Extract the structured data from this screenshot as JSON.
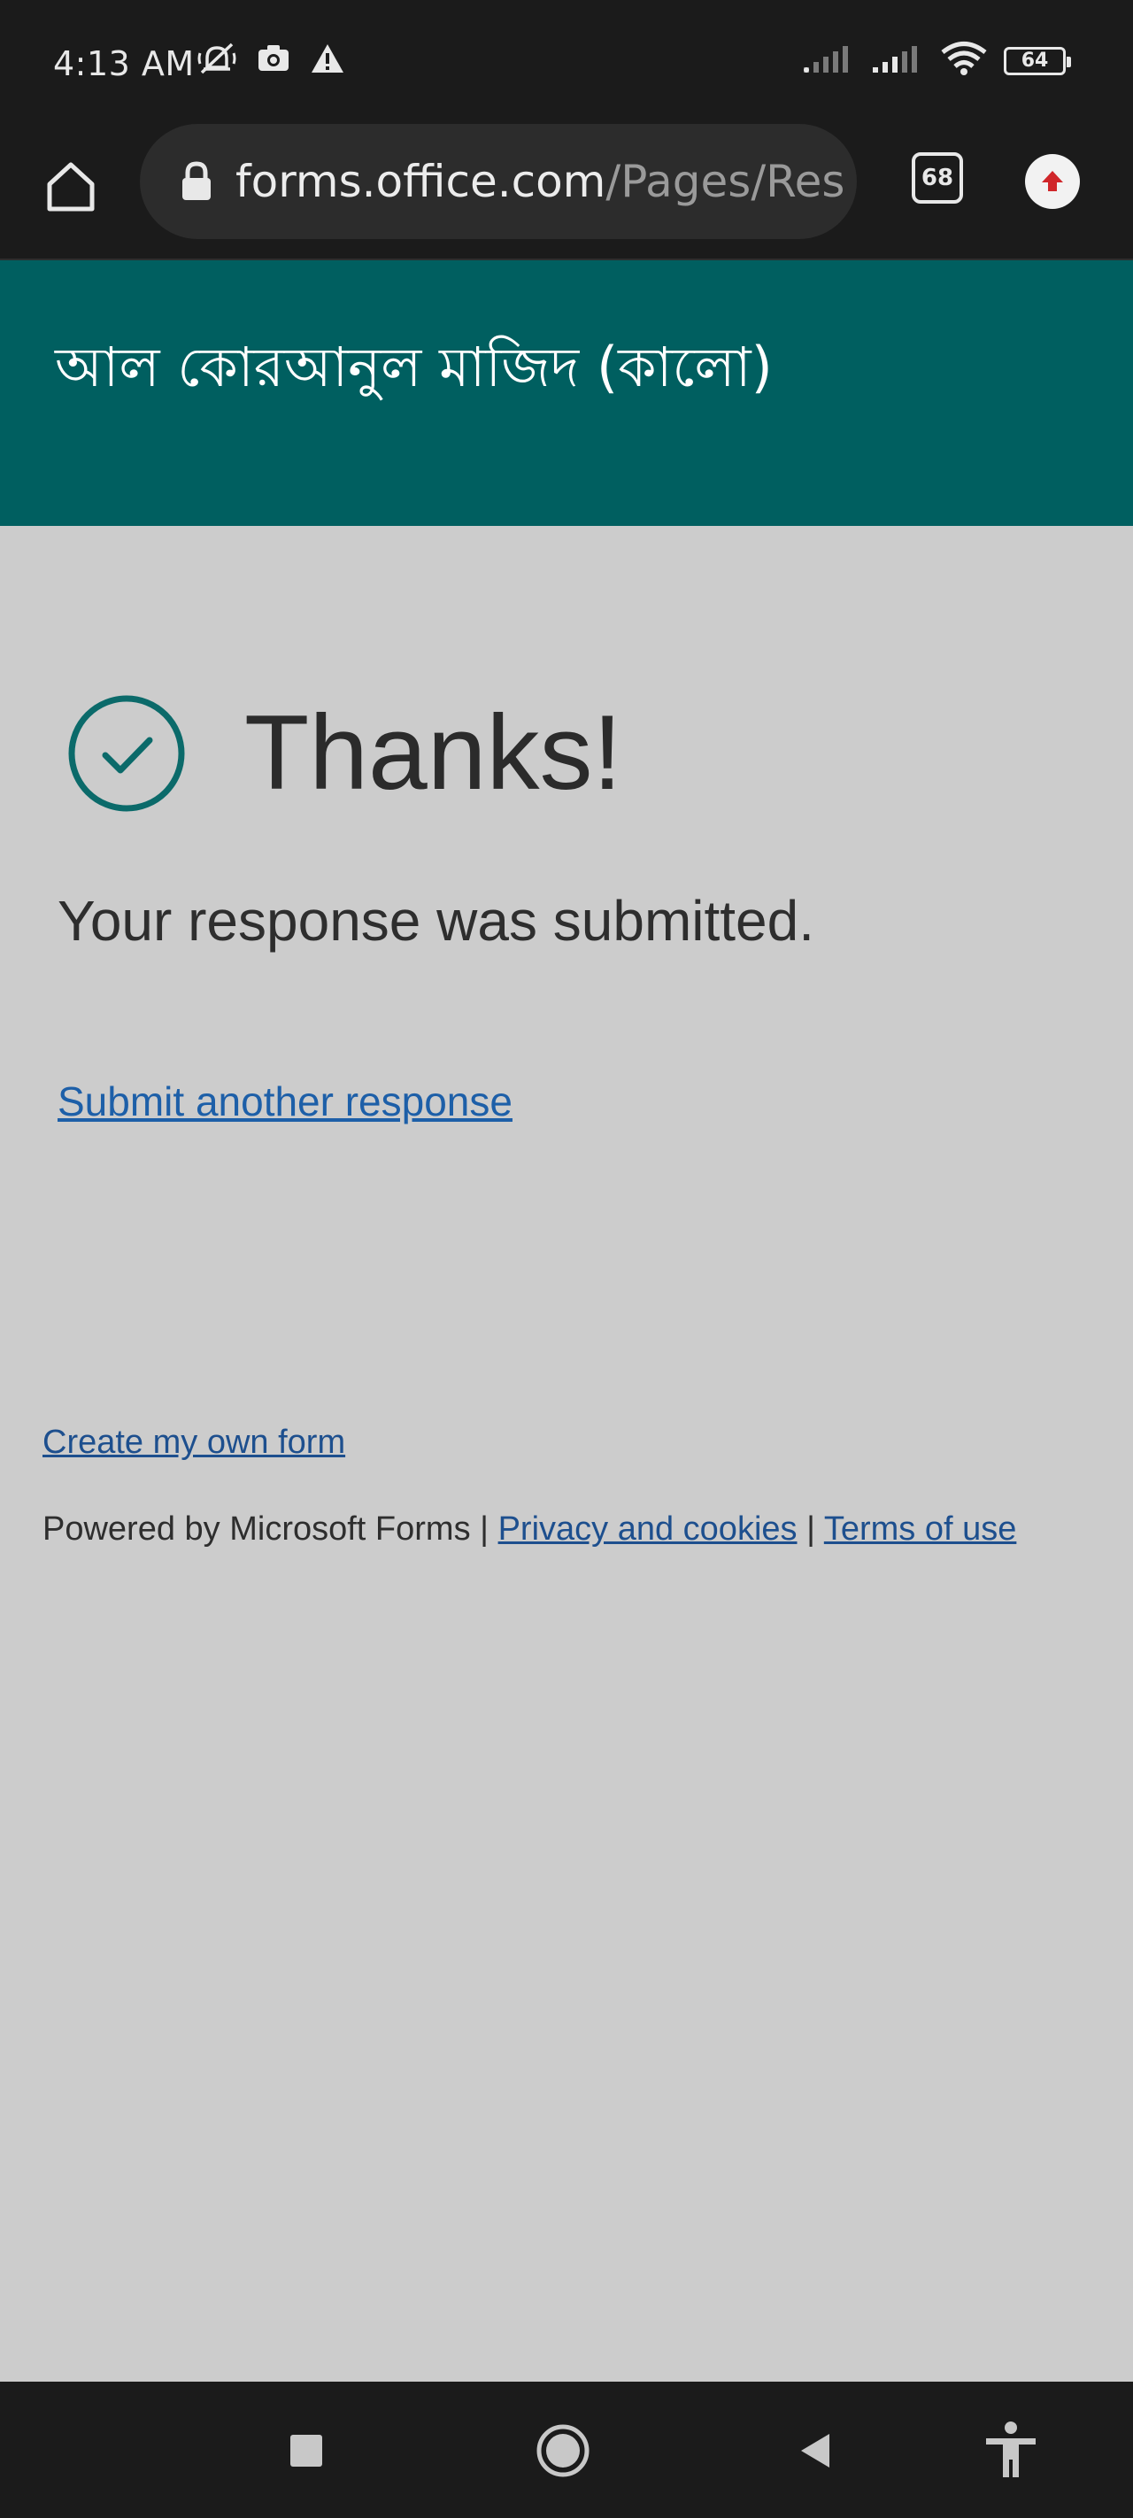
{
  "status_bar": {
    "time": "4:13 AM",
    "battery": "64",
    "icons": [
      "no-notification-icon",
      "camera-icon",
      "warning-icon",
      "signal-icon",
      "signal-icon",
      "wifi-icon",
      "battery-icon"
    ]
  },
  "browser": {
    "url_domain": "forms.office.com",
    "url_path": "/Pages/Res",
    "tab_count": "68",
    "icons": [
      "home-icon",
      "lock-icon",
      "tabs-icon",
      "update-icon"
    ]
  },
  "form": {
    "title": "আল কোরআনুল মাজিদ (কালো)"
  },
  "content": {
    "heading": "Thanks!",
    "message": "Your response was submitted.",
    "submit_another": "Submit another response"
  },
  "footer": {
    "create_form": "Create my own form",
    "powered_by": "Powered by Microsoft Forms",
    "separator": "|",
    "privacy": "Privacy and cookies",
    "terms": "Terms of use"
  },
  "colors": {
    "header_bg": "#005f60",
    "page_bg": "#cccccc",
    "link": "#1d5fa8",
    "check": "#0b6a6a"
  }
}
